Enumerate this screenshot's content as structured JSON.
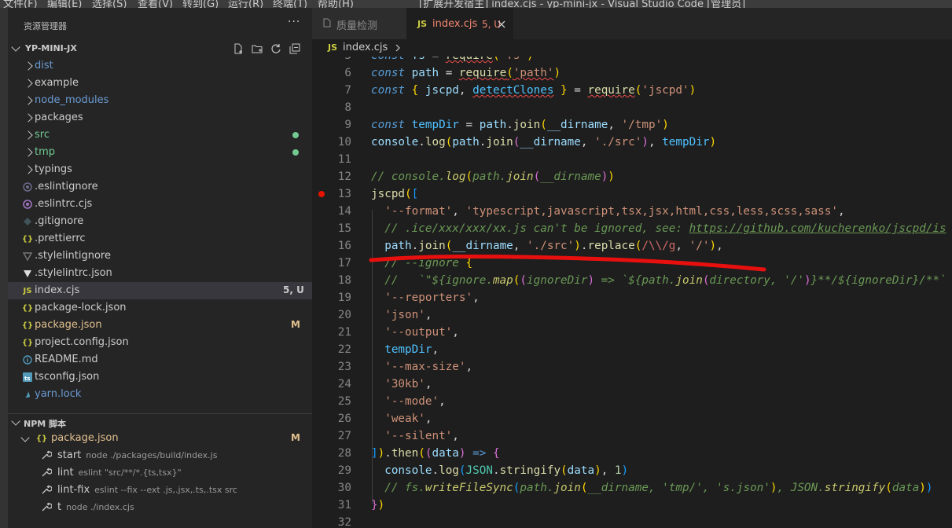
{
  "menu": [
    "文件(F)",
    "编辑(E)",
    "选择(S)",
    "查看(V)",
    "转到(G)",
    "运行(R)",
    "终端(T)",
    "帮助(H)"
  ],
  "window_title": "[扩展开发宿主] index.cjs - yp-mini-jx - Visual Studio Code [管理员]",
  "sidebar": {
    "title": "资源管理器",
    "more": "···",
    "project": "YP-MINI-JX",
    "items": [
      {
        "label": "dist",
        "kind": "folder",
        "color": "#6b9bd2"
      },
      {
        "label": "example",
        "kind": "folder",
        "color": "#cccccc"
      },
      {
        "label": "node_modules",
        "kind": "folder",
        "color": "#6b9bd2"
      },
      {
        "label": "packages",
        "kind": "folder",
        "color": "#cccccc"
      },
      {
        "label": "src",
        "kind": "folder",
        "color": "#73c991"
      },
      {
        "label": "tmp",
        "kind": "folder",
        "color": "#73c991"
      },
      {
        "label": "typings",
        "kind": "folder",
        "color": "#cccccc"
      },
      {
        "label": ".eslintignore",
        "kind": "file",
        "icon": "eslint-ignore-icon",
        "color": "#cccccc"
      },
      {
        "label": ".eslintrc.cjs",
        "kind": "file",
        "icon": "eslint-icon",
        "color": "#cccccc"
      },
      {
        "label": ".gitignore",
        "kind": "file",
        "icon": "git-icon",
        "color": "#cccccc"
      },
      {
        "label": ".prettierrc",
        "kind": "file",
        "icon": "braces-icon",
        "color": "#cccccc"
      },
      {
        "label": ".stylelintignore",
        "kind": "file",
        "icon": "stylelint-ignore-icon",
        "color": "#cccccc"
      },
      {
        "label": ".stylelintrc.json",
        "kind": "file",
        "icon": "stylelint-icon",
        "color": "#cccccc"
      },
      {
        "label": "index.cjs",
        "kind": "file",
        "icon": "js-icon",
        "color": "#cccccc",
        "badge": "5, U"
      },
      {
        "label": "package-lock.json",
        "kind": "file",
        "icon": "braces-icon",
        "color": "#cccccc"
      },
      {
        "label": "package.json",
        "kind": "file",
        "icon": "braces-icon",
        "color": "#e2c08d",
        "badge_m": "M"
      },
      {
        "label": "project.config.json",
        "kind": "file",
        "icon": "braces-icon",
        "color": "#cccccc"
      },
      {
        "label": "README.md",
        "kind": "file",
        "icon": "info-icon",
        "color": "#cccccc"
      },
      {
        "label": "tsconfig.json",
        "kind": "file",
        "icon": "ts-icon",
        "color": "#cccccc"
      },
      {
        "label": "yarn.lock",
        "kind": "file",
        "icon": "yarn-icon",
        "color": "#6b9bd2"
      }
    ],
    "npm_title": "NPM 脚本",
    "npm_package": "package.json",
    "npm_package_badge": "M",
    "scripts": [
      {
        "name": "start",
        "cmd": "node ./packages/build/index.js"
      },
      {
        "name": "lint",
        "cmd": "eslint \"src/**/*.{ts,tsx}\""
      },
      {
        "name": "lint-fix",
        "cmd": "eslint --fix --ext .js,.jsx,.ts,.tsx src"
      },
      {
        "name": "t",
        "cmd": "node ./index.cjs"
      }
    ]
  },
  "tabs": [
    {
      "label": "质量检测"
    },
    {
      "label": "index.cjs",
      "badge": "5, U"
    }
  ],
  "breadcrumb": "index.cjs",
  "editor": {
    "breakpoint_line": 13
  }
}
